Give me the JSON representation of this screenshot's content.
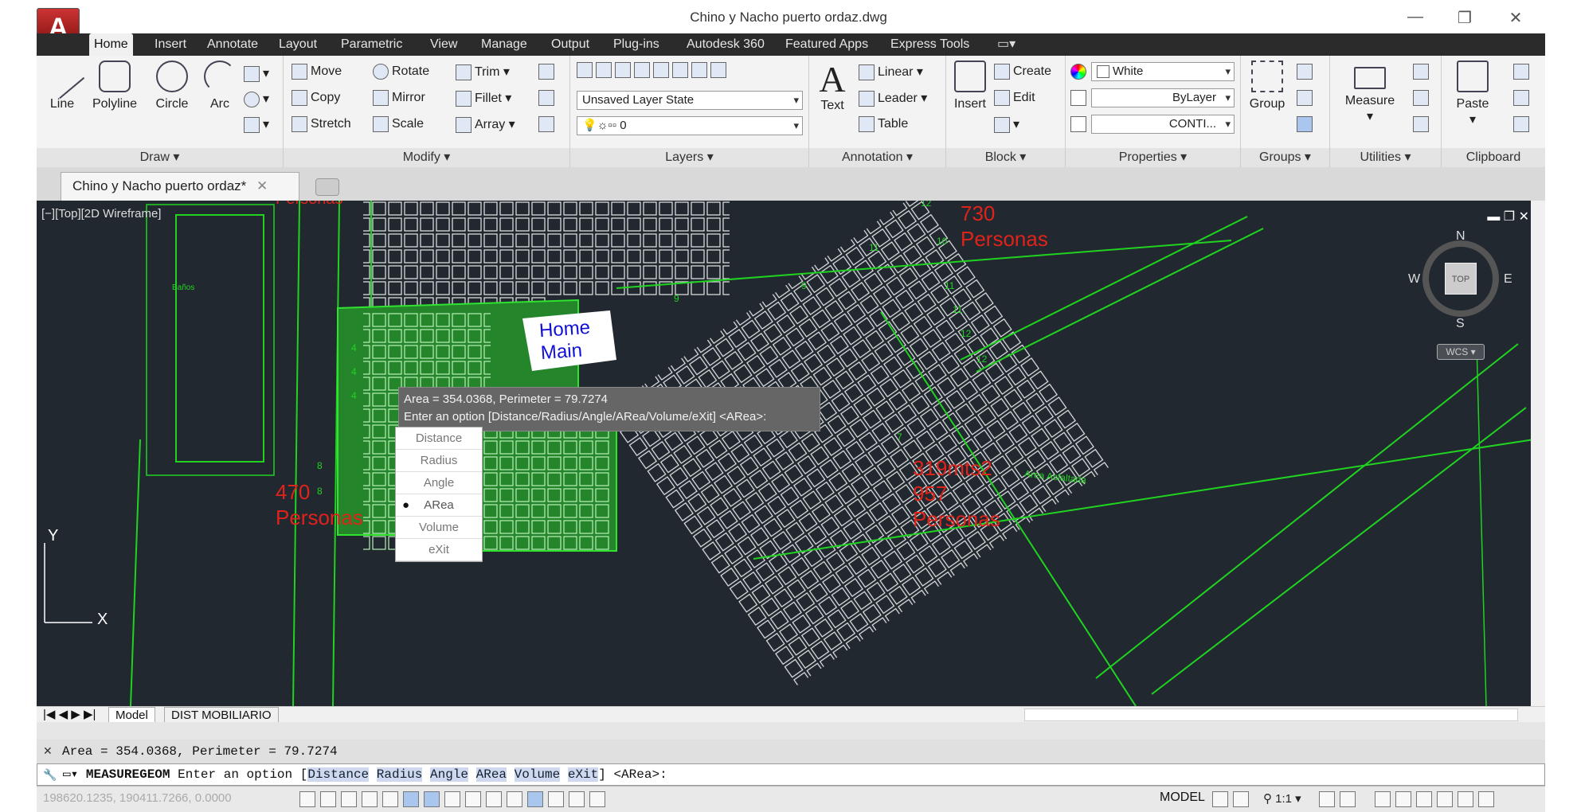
{
  "app": {
    "title": "Chino y Nacho puerto ordaz.dwg",
    "logo": "A"
  },
  "window_controls": {
    "minimize": "—",
    "restore": "❐",
    "close": "✕"
  },
  "tabs": [
    "Home",
    "Insert",
    "Annotate",
    "Layout",
    "Parametric",
    "View",
    "Manage",
    "Output",
    "Plug-ins",
    "Autodesk 360",
    "Featured Apps",
    "Express Tools"
  ],
  "ribbon": {
    "draw": {
      "title": "Draw",
      "line": "Line",
      "polyline": "Polyline",
      "circle": "Circle",
      "arc": "Arc"
    },
    "modify": {
      "title": "Modify",
      "move": "Move",
      "rotate": "Rotate",
      "trim": "Trim",
      "copy": "Copy",
      "mirror": "Mirror",
      "fillet": "Fillet",
      "stretch": "Stretch",
      "scale": "Scale",
      "array": "Array"
    },
    "layers": {
      "title": "Layers",
      "state": "Unsaved Layer State",
      "layer": "0"
    },
    "annotation": {
      "title": "Annotation",
      "text": "Text",
      "linear": "Linear",
      "leader": "Leader",
      "table": "Table"
    },
    "block": {
      "title": "Block",
      "insert": "Insert",
      "create": "Create",
      "edit": "Edit"
    },
    "properties": {
      "title": "Properties",
      "color": "White",
      "linetype": "ByLayer",
      "lineweight": "CONTI..."
    },
    "groups": {
      "title": "Groups",
      "group": "Group"
    },
    "utilities": {
      "title": "Utilities",
      "measure": "Measure"
    },
    "clipboard": {
      "title": "Clipboard",
      "paste": "Paste"
    }
  },
  "document_tab": "Chino y Nacho puerto ordaz*",
  "viewport": {
    "label": "[−][Top][2D Wireframe]",
    "labels": {
      "home": "Home",
      "main": "Main",
      "p730": "730",
      "p730b": "Personas",
      "p470": "470",
      "p470b": "Personas",
      "area319": "319mts2",
      "p957": "957",
      "p957b": "Personas",
      "banos": "Baños",
      "personas_top": "Personas",
      "asfaltada": "Area Asfaltada"
    },
    "compass": {
      "n": "N",
      "s": "S",
      "e": "E",
      "w": "W",
      "top": "TOP",
      "wcs": "WCS"
    },
    "axis": {
      "y": "Y",
      "x": "X"
    },
    "row_numbers": [
      "12",
      "9",
      "10",
      "11",
      "11",
      "11",
      "12",
      "12",
      "7",
      "9",
      "4",
      "4",
      "4",
      "8",
      "8",
      "5"
    ]
  },
  "tooltip": {
    "line1": "Area = 354.0368, Perimeter = 79.7274",
    "line2": "Enter an option [Distance/Radius/Angle/ARea/Volume/eXit] <ARea>:"
  },
  "menu": [
    {
      "label": "Distance",
      "checked": false
    },
    {
      "label": "Radius",
      "checked": false
    },
    {
      "label": "Angle",
      "checked": false
    },
    {
      "label": "ARea",
      "checked": true
    },
    {
      "label": "Volume",
      "checked": false
    },
    {
      "label": "eXit",
      "checked": false
    }
  ],
  "layout_tabs": {
    "model": "Model",
    "dist": "DIST MOBILIARIO"
  },
  "command": {
    "history": "Area = 354.0368, Perimeter = 79.7274",
    "name": "MEASUREGEOM",
    "prompt": "Enter an option",
    "options": [
      "Distance",
      "Radius",
      "Angle",
      "ARea",
      "Volume",
      "eXit"
    ],
    "default": "<ARea>:"
  },
  "status": {
    "coords": "198620.1235, 190411.7266, 0.0000",
    "model": "MODEL",
    "scale": "1:1"
  },
  "colors": {
    "green": "#21d321",
    "red": "#e0231a",
    "canvas": "#212830"
  }
}
